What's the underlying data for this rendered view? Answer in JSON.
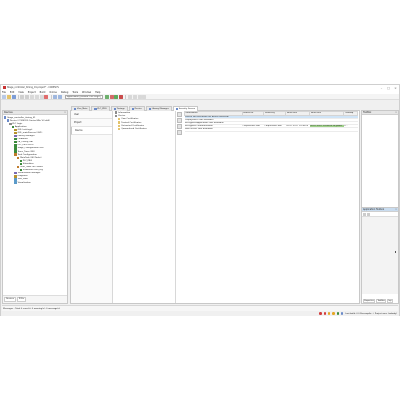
{
  "window": {
    "title": "Stage_controller_timing_01.project* - CODESYS"
  },
  "menu": [
    "File",
    "Edit",
    "View",
    "Project",
    "Build",
    "Online",
    "Debug",
    "Tools",
    "Window",
    "Help"
  ],
  "toolbar": {
    "application_combo": "Application [Device: PLC Logic]"
  },
  "devices_panel": {
    "title": "Devices",
    "tree": [
      {
        "label": "Stage_controller_timing_01",
        "level": 0,
        "color": "#6a8ac9"
      },
      {
        "label": "Device (CODESYS Control Win V3 x64)",
        "level": 1,
        "color": "#6a8ac9"
      },
      {
        "label": "PLC Logic",
        "level": 2,
        "color": "#8c8c8c"
      },
      {
        "label": "Application",
        "level": 3,
        "color": "#3a8a3a"
      },
      {
        "label": "GVL (settings)",
        "level": 4,
        "color": "#b7922a"
      },
      {
        "label": "GVL_mainProcess (GVL)",
        "level": 4,
        "color": "#b7922a"
      },
      {
        "label": "Library Manager",
        "level": 4,
        "color": "#7a6bb3"
      },
      {
        "label": "ColdBlock",
        "level": 4,
        "color": "#3a8a3a"
      },
      {
        "label": "FB_Timing (FB)",
        "level": 4,
        "color": "#3a8a3a"
      },
      {
        "label": "PLC_PRG (PRG)",
        "level": 4,
        "color": "#3a8a3a"
      },
      {
        "label": "Stage_Configuration (FB)",
        "level": 4,
        "color": "#3a8a3a"
      },
      {
        "label": "Trace_Trace (FB)",
        "level": 4,
        "color": "#3a8a3a"
      },
      {
        "label": "Task Configuration",
        "level": 4,
        "color": "#c07a2a"
      },
      {
        "label": "MainTask (IEC-Tasks)",
        "level": 5,
        "color": "#c07a2a"
      },
      {
        "label": "PLC_PRG",
        "level": 6,
        "color": "#3a8a3a"
      },
      {
        "label": "Stimulator",
        "level": 6,
        "color": "#3a8a3a"
      },
      {
        "label": "VISU_TASK (IEC-Tasks)",
        "level": 5,
        "color": "#c07a2a"
      },
      {
        "label": "VisuElems.Visu_Prg",
        "level": 6,
        "color": "#3a8a3a"
      },
      {
        "label": "Visualization Manager",
        "level": 4,
        "color": "#7a6bb3"
      },
      {
        "label": "Diagrams",
        "level": 4,
        "color": "#b7922a"
      },
      {
        "label": "Visu_Main",
        "level": 4,
        "color": "#5a9ac9"
      },
      {
        "label": "Visualization",
        "level": 4,
        "color": "#5a9ac9"
      }
    ],
    "bottom_tabs": [
      "Devices",
      "POUs"
    ]
  },
  "editor": {
    "tabs": [
      {
        "label": "Visu_Main",
        "active": false
      },
      {
        "label": "PLC_PRG",
        "active": false
      },
      {
        "label": "Timings",
        "active": false
      },
      {
        "label": "Device",
        "active": false
      },
      {
        "label": "Library Manager",
        "active": false
      },
      {
        "label": "Security Screen",
        "active": true
      }
    ],
    "nav": [
      "User",
      "Project",
      "Device"
    ],
    "nav_selected": "Device",
    "cert_tree": [
      {
        "label": "Information",
        "level": 0
      },
      {
        "label": "Device",
        "level": 0
      },
      {
        "label": "Own Certificates",
        "level": 1
      },
      {
        "label": "Trusted Certificates",
        "level": 1
      },
      {
        "label": "Untrusted Certificates",
        "level": 1
      },
      {
        "label": "Quarantined Certificates",
        "level": 1
      }
    ],
    "grid": {
      "columns": [
        "Information",
        "Issued for",
        "Issued by",
        "Valid until",
        "Valid until",
        "Thumbp"
      ],
      "rows": [
        {
          "cells": [
            "Device (No certificate for device selected)",
            "",
            "",
            "",
            "",
            ""
          ],
          "highlight": true
        },
        {
          "cells": [
            "Deployment (Not available)",
            "",
            "",
            "",
            "",
            ""
          ],
          "highlight": false
        },
        {
          "cells": [
            "Encrypted Application (Not available)",
            "",
            "",
            "",
            "",
            ""
          ],
          "highlight": false
        },
        {
          "cells": [
            "Encrypted Communication",
            "CmpSecureChan",
            "CmpSecureChan",
            "20.07.2017 13:38:25",
            "20.07.2027 13:38:25 (8 years)",
            "3..."
          ],
          "highlight": false,
          "green_col": 4
        },
        {
          "cells": [
            "Web Server (Not available)",
            "",
            "",
            "",
            "",
            ""
          ],
          "highlight": false
        }
      ]
    }
  },
  "toolbox": {
    "title": "ToolBox"
  },
  "properties": {
    "title": "Application Toolbox"
  },
  "right_tabs": [
    "Properties",
    "ToolBox",
    "Inp"
  ],
  "messages": {
    "label": "Messages - Total 0 error(s), 0 warning(s), 0 message(s)"
  },
  "status": {
    "items": [
      {
        "color": "#d23b3b"
      },
      {
        "color": "#d23b3b"
      },
      {
        "color": "#e6a623"
      },
      {
        "color": "#e6a623"
      },
      {
        "color": "#3a8a3a"
      },
      {
        "color": "#6a8ac9"
      }
    ],
    "text": "Last build: 0 0   Precompile: ✓   Project user: (nobody)"
  }
}
